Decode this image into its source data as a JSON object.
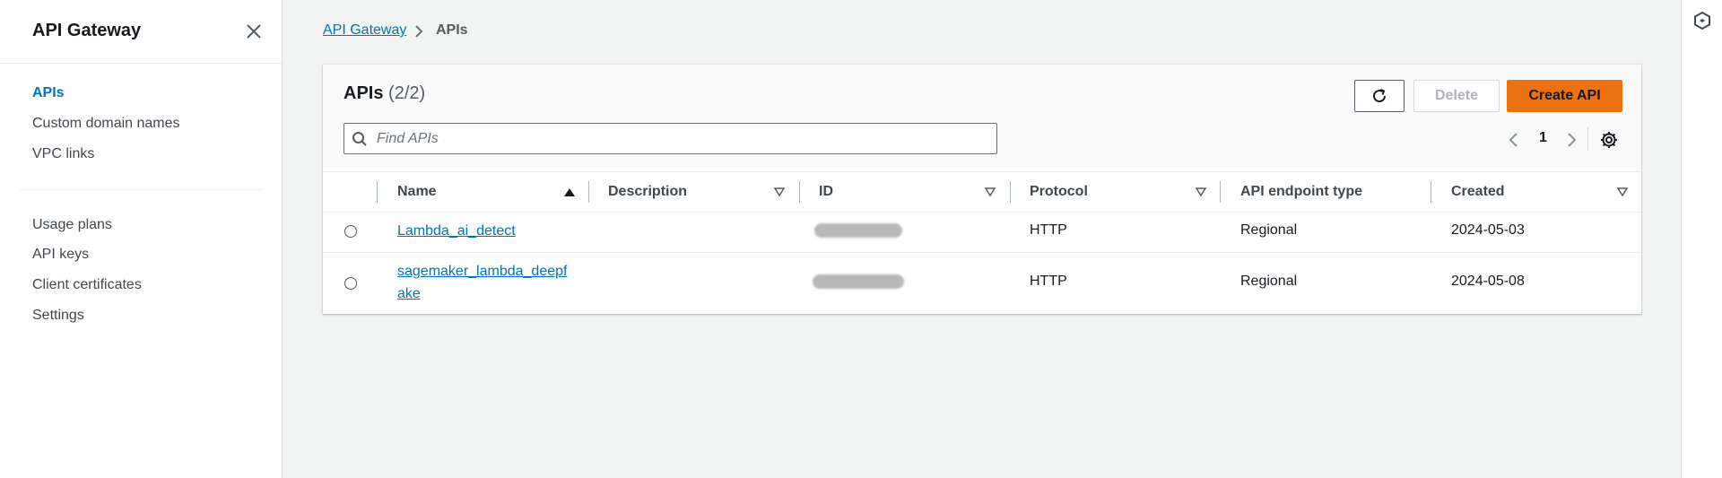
{
  "sidebar": {
    "title": "API Gateway",
    "nav_primary": [
      "APIs",
      "Custom domain names",
      "VPC links"
    ],
    "nav_secondary": [
      "Usage plans",
      "API keys",
      "Client certificates",
      "Settings"
    ],
    "active_item": "APIs"
  },
  "breadcrumb": {
    "parent": "API Gateway",
    "current": "APIs"
  },
  "panel": {
    "title": "APIs",
    "count": "(2/2)",
    "buttons": {
      "delete": "Delete",
      "create": "Create API"
    },
    "search": {
      "placeholder": "Find APIs",
      "value": ""
    },
    "pagination": {
      "current_page": "1"
    }
  },
  "table": {
    "columns": [
      "Name",
      "Description",
      "ID",
      "Protocol",
      "API endpoint type",
      "Created"
    ],
    "sorted_column": "Name",
    "rows": [
      {
        "name": "Lambda_ai_detect",
        "description": "",
        "id": "[redacted]",
        "protocol": "HTTP",
        "endpoint_type": "Regional",
        "created": "2024-05-03"
      },
      {
        "name_line1": "sagemaker_lambda_deepf",
        "name_line2": "ake",
        "description": "",
        "id": "[redacted]",
        "protocol": "HTTP",
        "endpoint_type": "Regional",
        "created": "2024-05-08"
      }
    ]
  },
  "colors": {
    "accent_link": "#0073bb",
    "primary_button": "#ec7211",
    "background": "#f2f3f3"
  },
  "icons": [
    "close-icon",
    "chevron-right-icon",
    "refresh-icon",
    "search-icon",
    "chevron-left-icon",
    "gear-icon",
    "sort-asc-icon",
    "sort-desc-icon",
    "hexagon-icon"
  ]
}
